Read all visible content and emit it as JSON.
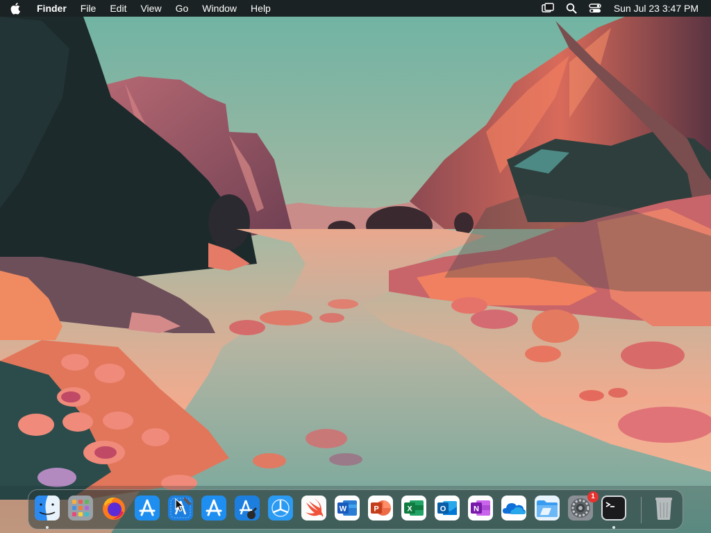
{
  "menubar": {
    "app_name": "Finder",
    "menus": [
      "File",
      "Edit",
      "View",
      "Go",
      "Window",
      "Help"
    ],
    "status_icons": [
      "screen-mirroring-icon",
      "spotlight-search-icon",
      "control-center-icon"
    ],
    "clock": "Sun Jul 23  3:47 PM"
  },
  "dock": {
    "apps": [
      {
        "name": "finder",
        "icon": "finder-icon",
        "running": true
      },
      {
        "name": "launchpad",
        "icon": "launchpad-icon",
        "running": false
      },
      {
        "name": "firefox",
        "icon": "firefox-icon",
        "running": false
      },
      {
        "name": "app-store",
        "icon": "app-store-icon",
        "running": false
      },
      {
        "name": "xcode",
        "icon": "xcode-icon",
        "running": false
      },
      {
        "name": "app-store-2",
        "icon": "app-store-icon",
        "running": false
      },
      {
        "name": "instruments",
        "icon": "instruments-icon",
        "running": false
      },
      {
        "name": "testflight",
        "icon": "testflight-icon",
        "running": false
      },
      {
        "name": "swift-playgrounds",
        "icon": "swift-icon",
        "running": false
      },
      {
        "name": "microsoft-word",
        "icon": "word-icon",
        "running": false
      },
      {
        "name": "microsoft-powerpoint",
        "icon": "powerpoint-icon",
        "running": false
      },
      {
        "name": "microsoft-excel",
        "icon": "excel-icon",
        "running": false
      },
      {
        "name": "microsoft-outlook",
        "icon": "outlook-icon",
        "running": false
      },
      {
        "name": "microsoft-onenote",
        "icon": "onenote-icon",
        "running": false
      },
      {
        "name": "onedrive",
        "icon": "onedrive-icon",
        "running": false
      },
      {
        "name": "file-explorer",
        "icon": "folder-icon",
        "running": false
      },
      {
        "name": "system-settings",
        "icon": "gear-icon",
        "running": false,
        "badge": "1"
      },
      {
        "name": "terminal",
        "icon": "terminal-icon",
        "running": true
      }
    ],
    "trash": {
      "name": "trash",
      "icon": "trash-icon"
    }
  },
  "colors": {
    "sky_top": "#6fb3a2",
    "sky_horizon": "#f2a98e",
    "water": "#8fb8ac",
    "rock_orange": "#e8775a",
    "rock_pink": "#c86a78",
    "shadow_teal": "#1f4a4a"
  }
}
